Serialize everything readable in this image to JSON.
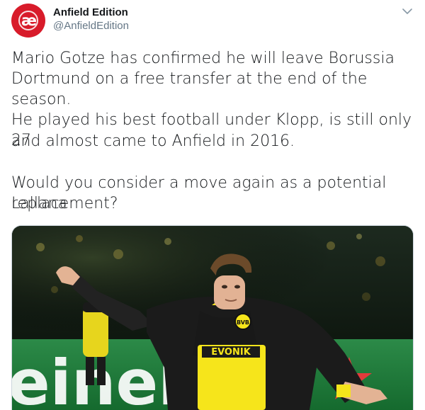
{
  "tweet": {
    "author_name": "Anfield Edition",
    "author_handle": "@AnfieldEdition",
    "avatar_logo_text": "æ",
    "paragraphs": [
      [
        "Mario Gotze has confirmed he will leave Borussia",
        "Dortmund on a free transfer at the end of the season."
      ],
      [
        "He played his best football under Klopp, is still only 27",
        "and almost came to Anfield in 2016."
      ],
      [
        "Would you consider a move again as a potential Lallana",
        "replacement?"
      ]
    ]
  },
  "media": {
    "description": "photo",
    "shirt_sponsor": "EVONIK",
    "crest_text": "BVB",
    "board_text": "einek"
  },
  "icons": {
    "caret": "chevron-down-icon"
  },
  "colors": {
    "avatar_bg": "#d81b2a",
    "handle": "#657786",
    "text": "#14171a",
    "shirt_yellow": "#f6e51b",
    "board_green": "#1c7c3a"
  }
}
